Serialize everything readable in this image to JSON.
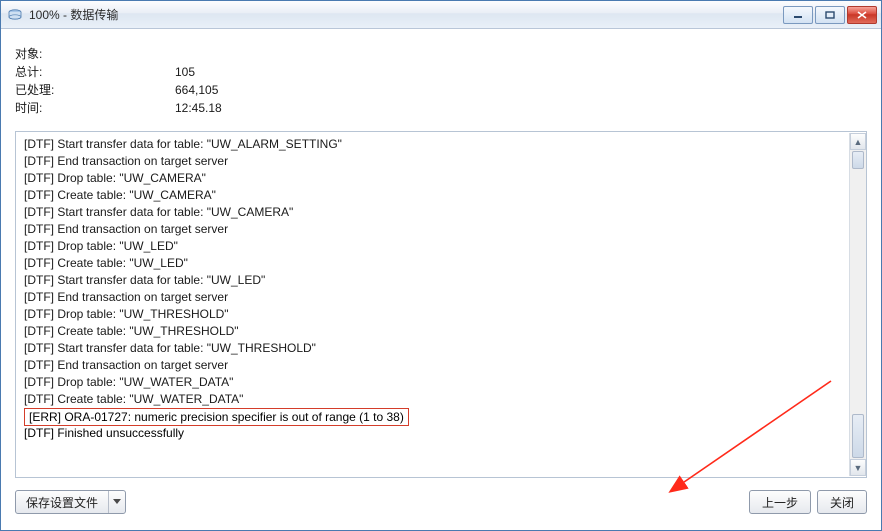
{
  "window": {
    "title": "100% - 数据传输"
  },
  "summary": {
    "object_label": "对象:",
    "object_value": "",
    "total_label": "总计:",
    "total_value": "105",
    "processed_label": "已处理:",
    "processed_value": "664,105",
    "time_label": "时间:",
    "time_value": "12:45.18"
  },
  "log": [
    "[DTF] Start transfer data for table: \"UW_ALARM_SETTING\"",
    "[DTF] End transaction on target server",
    "[DTF] Drop table: \"UW_CAMERA\"",
    "[DTF] Create table: \"UW_CAMERA\"",
    "[DTF] Start transfer data for table: \"UW_CAMERA\"",
    "[DTF] End transaction on target server",
    "[DTF] Drop table: \"UW_LED\"",
    "[DTF] Create table: \"UW_LED\"",
    "[DTF] Start transfer data for table: \"UW_LED\"",
    "[DTF] End transaction on target server",
    "[DTF] Drop table: \"UW_THRESHOLD\"",
    "[DTF] Create table: \"UW_THRESHOLD\"",
    "[DTF] Start transfer data for table: \"UW_THRESHOLD\"",
    "[DTF] End transaction on target server",
    "[DTF] Drop table: \"UW_WATER_DATA\"",
    "[DTF] Create table: \"UW_WATER_DATA\""
  ],
  "log_error": "[ERR] ORA-01727: numeric precision specifier is out of range (1 to 38)",
  "log_tail": "[DTF] Finished unsuccessfully",
  "buttons": {
    "save_settings": "保存设置文件",
    "prev": "上一步",
    "close": "关闭"
  },
  "colors": {
    "error_border": "#d43d2a",
    "arrow": "#ff2a1a"
  }
}
